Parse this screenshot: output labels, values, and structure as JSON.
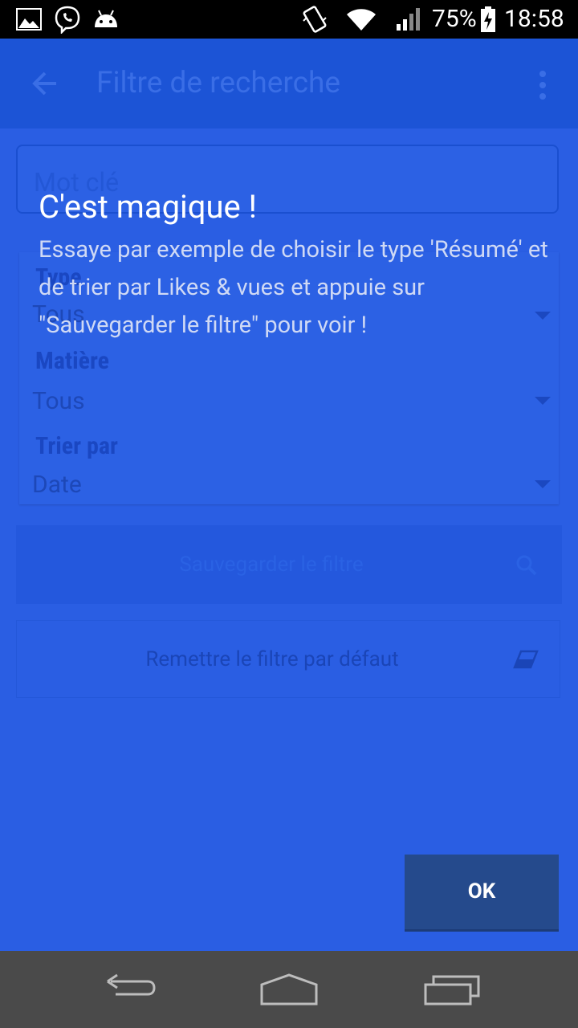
{
  "status_bar": {
    "battery": "75%",
    "time": "18:58",
    "icons": [
      "gallery-icon",
      "viber-icon",
      "android-icon",
      "vibrate-icon",
      "wifi-icon",
      "signal-icon",
      "battery-charging-icon"
    ]
  },
  "app_bar": {
    "title": "Filtre de recherche",
    "back_icon": "arrow-back-icon",
    "menu_icon": "overflow-menu-icon"
  },
  "form": {
    "keyword_placeholder": "Mot clé",
    "type_label": "Type",
    "type_value": "Tous",
    "subject_label": "Matière",
    "subject_value": "Tous",
    "sort_label": "Trier par",
    "sort_value": "Date",
    "save_label": "Sauvegarder le filtre",
    "reset_label": "Remettre le filtre par défaut"
  },
  "tip": {
    "title": "C'est magique !",
    "body": "Essaye par exemple de choisir le type 'Résumé' et de trier par Likes & vues et appuie sur \"Sauvegarder le filtre\" pour voir !",
    "ok_label": "OK"
  },
  "nav_bar": {
    "buttons": [
      "back-nav-icon",
      "home-nav-icon",
      "recents-nav-icon"
    ]
  },
  "colors": {
    "overlay_blue": "#2a5ee3",
    "ok_button": "#254a8c",
    "status_bar": "#000000",
    "nav_bar": "#4a4a4a"
  }
}
